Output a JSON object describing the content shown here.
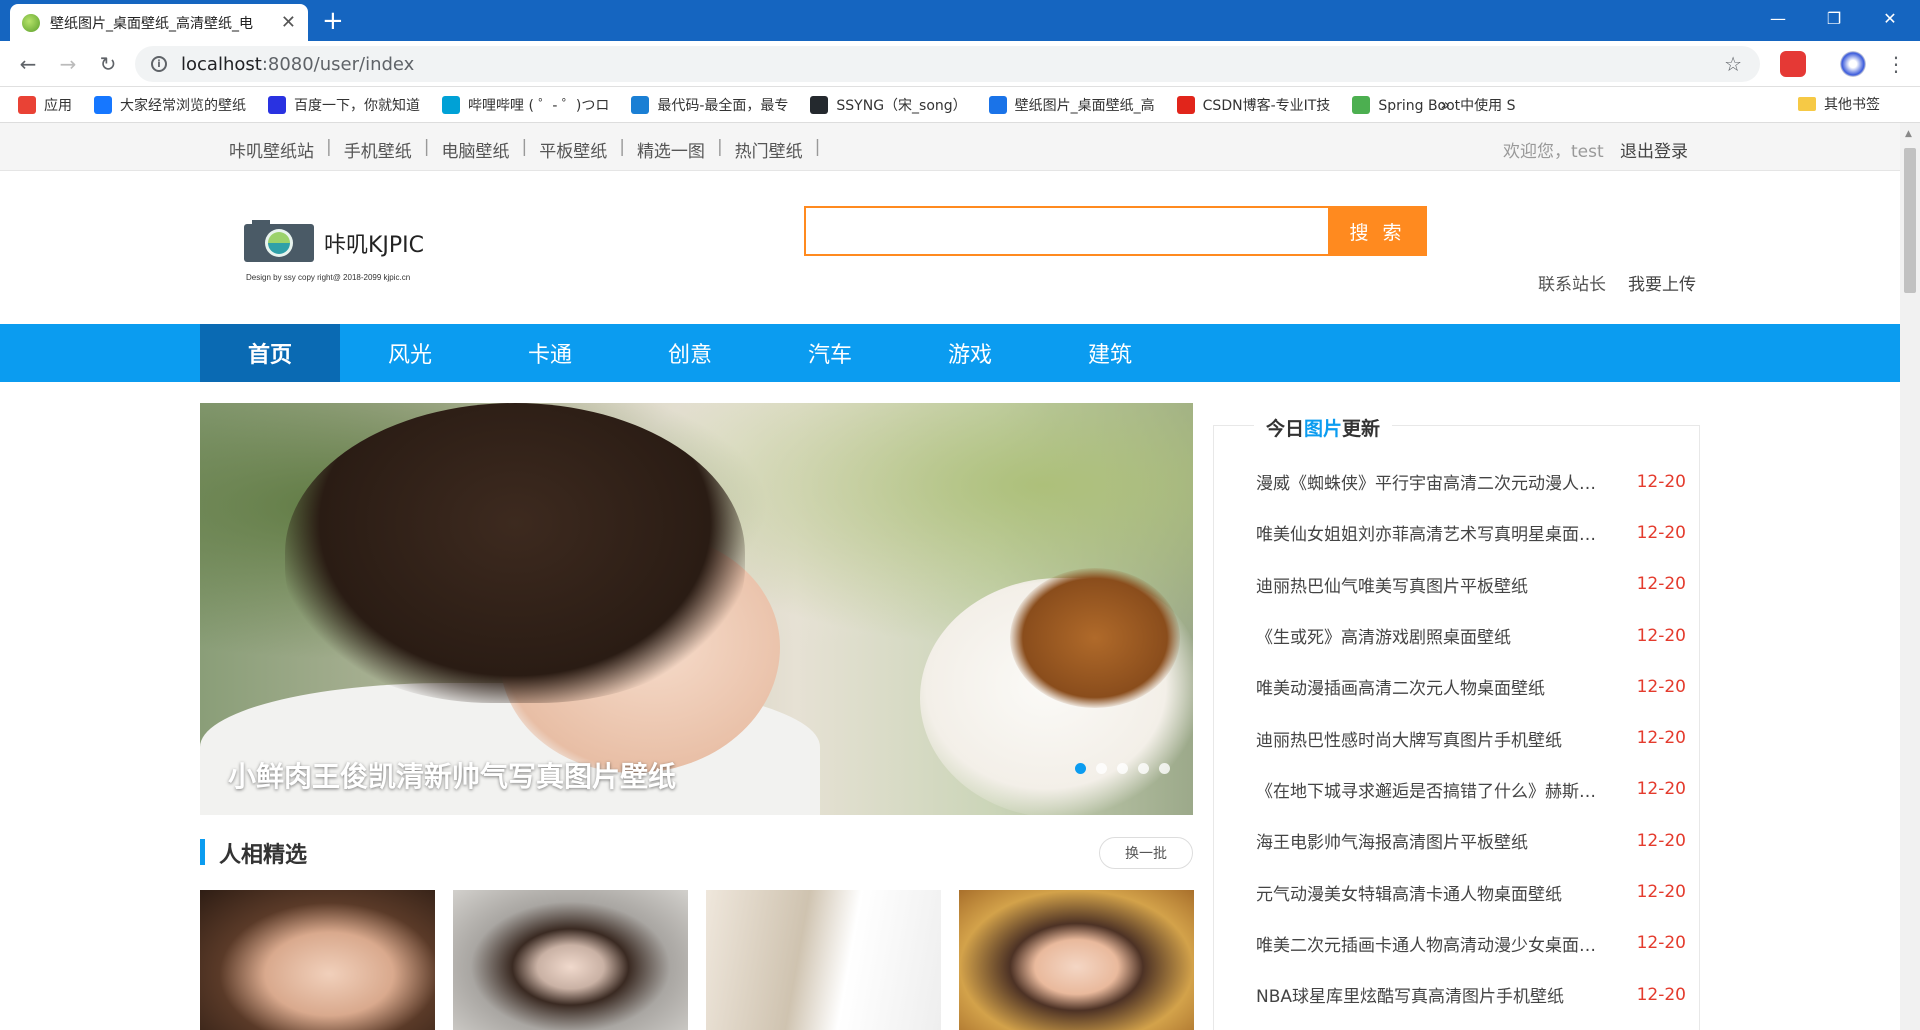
{
  "browser": {
    "tab_title": "壁纸图片_桌面壁纸_高清壁纸_电",
    "url_host": "localhost",
    "url_path": ":8080/user/index",
    "bookmarks": [
      {
        "label": "应用",
        "color": "#e94235"
      },
      {
        "label": "大家经常浏览的壁纸",
        "color": "#1677ff"
      },
      {
        "label": "百度一下，你就知道",
        "color": "#2932e1"
      },
      {
        "label": "哔哩哔哩 ( ゜- ゜)つロ",
        "color": "#00a1d6"
      },
      {
        "label": "最代码-最全面，最专",
        "color": "#1a7fd4"
      },
      {
        "label": "SSYNG（宋_song）",
        "color": "#24292e"
      },
      {
        "label": "壁纸图片_桌面壁纸_高",
        "color": "#1a73e8"
      },
      {
        "label": "CSDN博客-专业IT技",
        "color": "#e1251b"
      },
      {
        "label": "Spring Boot中使用 S",
        "color": "#4caf50"
      }
    ],
    "bookmarks_more": "»",
    "other_bookmarks": "其他书签"
  },
  "site": {
    "top_links": [
      "咔叽壁纸站",
      "手机壁纸",
      "电脑壁纸",
      "平板壁纸",
      "精选一图",
      "热门壁纸"
    ],
    "welcome": "欢迎您，test",
    "logout": "退出登录",
    "logo_text": "咔叽KJPIC",
    "logo_sub": "Design by ssy copy right@ 2018-2099 kjpic.cn",
    "search_placeholder": "",
    "search_button": "搜 索",
    "contact": "联系站长",
    "upload": "我要上传",
    "nav": [
      "首页",
      "风光",
      "卡通",
      "创意",
      "汽车",
      "游戏",
      "建筑"
    ],
    "carousel_caption": "小鲜肉王俊凯清新帅气写真图片壁纸",
    "carousel_dots": 5,
    "section_title": "人相精选",
    "section_refresh": "换一批",
    "sidebar_head_a": "今日",
    "sidebar_head_b": "图片",
    "sidebar_head_c": "更新",
    "updates": [
      {
        "title": "漫威《蜘蛛侠》平行宇宙高清二次元动漫人物桌面壁纸",
        "date": "12-20"
      },
      {
        "title": "唯美仙女姐姐刘亦菲高清艺术写真明星桌面壁纸",
        "date": "12-20"
      },
      {
        "title": "迪丽热巴仙气唯美写真图片平板壁纸",
        "date": "12-20"
      },
      {
        "title": "《生或死》高清游戏剧照桌面壁纸",
        "date": "12-20"
      },
      {
        "title": "唯美动漫插画高清二次元人物桌面壁纸",
        "date": "12-20"
      },
      {
        "title": "迪丽热巴性感时尚大牌写真图片手机壁纸",
        "date": "12-20"
      },
      {
        "title": "《在地下城寻求邂逅是否搞错了什么》赫斯缇雅壁纸",
        "date": "12-20"
      },
      {
        "title": "海王电影帅气海报高清图片平板壁纸",
        "date": "12-20"
      },
      {
        "title": "元气动漫美女特辑高清卡通人物桌面壁纸",
        "date": "12-20"
      },
      {
        "title": "唯美二次元插画卡通人物高清动漫少女桌面壁纸",
        "date": "12-20"
      },
      {
        "title": "NBA球星库里炫酷写真高清图片手机壁纸",
        "date": "12-20"
      }
    ]
  }
}
